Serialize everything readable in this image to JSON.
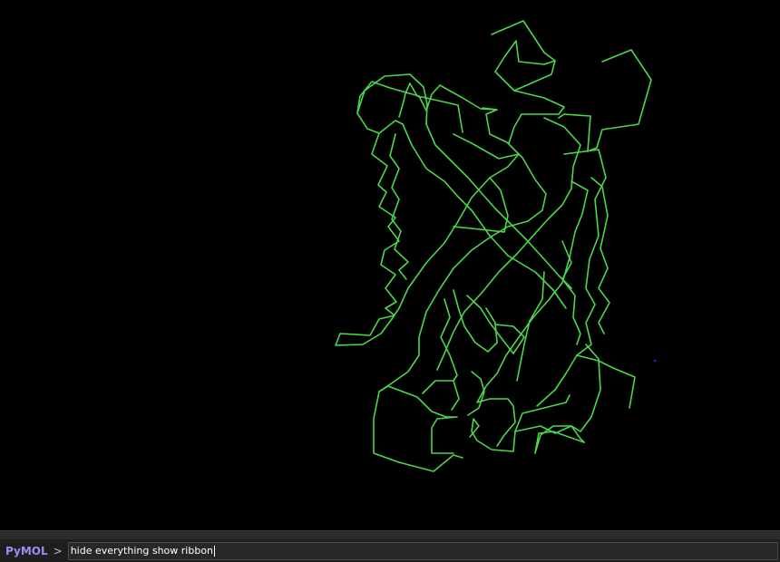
{
  "viewer": {
    "background_color": "#000000",
    "ribbon_color": "#4ee44e",
    "representation": "ribbon"
  },
  "command_line": {
    "prompt_label": "PyMOL",
    "prompt_symbol": ">",
    "input_value": "hide everything show ribbon",
    "prompt_color": "#9e8cf5"
  }
}
